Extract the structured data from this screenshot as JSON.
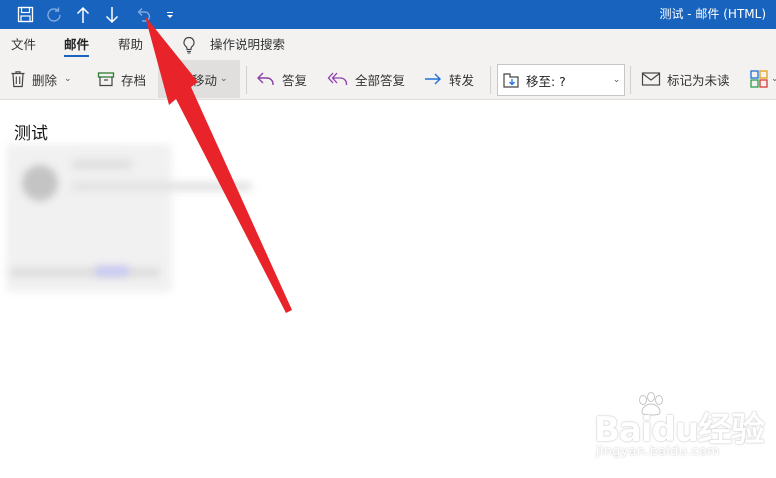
{
  "window": {
    "title": "测试  -  邮件 (HTML)"
  },
  "menu": {
    "tabs": [
      {
        "label": "文件"
      },
      {
        "label": "邮件"
      },
      {
        "label": "帮助"
      }
    ],
    "active_tab": "邮件",
    "tell_me": "操作说明搜索"
  },
  "ribbon": {
    "delete": "删除",
    "archive": "存档",
    "move": "移动",
    "reply": "答复",
    "reply_all": "全部答复",
    "forward": "转发",
    "move_to": "移至: ?",
    "mark_unread": "标记为未读"
  },
  "message": {
    "subject": "测试"
  },
  "watermark": {
    "brand": "Baidu经验",
    "url": "jingyan.baidu.com"
  },
  "colors": {
    "titlebar": "#1763bd",
    "arrow": "#e8232a",
    "ribbon_bg": "#f3f2f1",
    "reply_purple": "#8b3fa8"
  },
  "icons": [
    "save-icon",
    "redo-icon",
    "up-arrow-icon",
    "down-arrow-icon",
    "undo-icon",
    "customize-toolbar-icon",
    "lightbulb-icon",
    "delete-icon",
    "archive-icon",
    "move-icon",
    "reply-icon",
    "reply-all-icon",
    "forward-icon",
    "move-to-icon",
    "mark-unread-icon",
    "apps-icon"
  ]
}
